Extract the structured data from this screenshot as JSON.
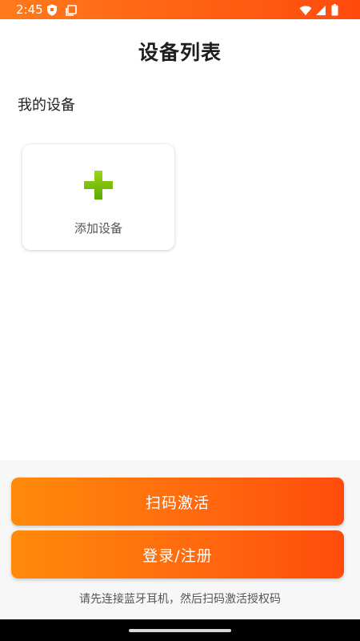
{
  "status_bar": {
    "time": "2:45",
    "icons": [
      "shield-icon",
      "screen-icon",
      "wifi-icon",
      "signal-icon",
      "battery-icon"
    ],
    "background": "#ff5a12"
  },
  "header": {
    "title": "设备列表"
  },
  "devices": {
    "section_label": "我的设备",
    "add_card": {
      "icon": "plus-icon",
      "label": "添加设备",
      "icon_color": "#7cc400"
    }
  },
  "bottom": {
    "scan_button_label": "扫码激活",
    "login_button_label": "登录/注册",
    "hint": "请先连接蓝牙耳机，然后扫码激活授权码",
    "button_gradient": [
      "#ff8a0a",
      "#ff4c0c"
    ]
  }
}
